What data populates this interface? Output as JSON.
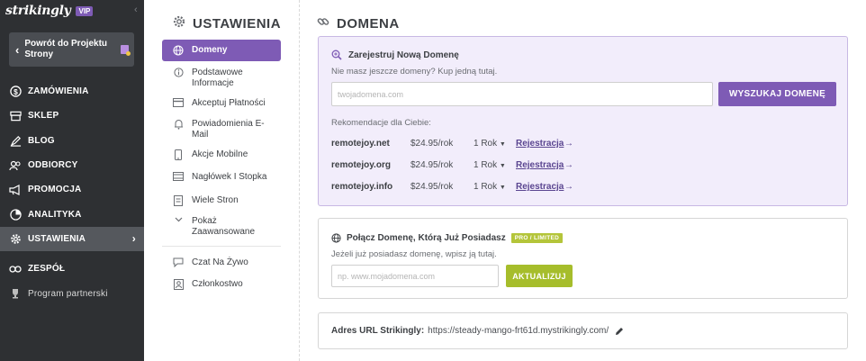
{
  "brand": {
    "logo": "strikingly",
    "vip": "VIP"
  },
  "back_button": {
    "label": "Powrót do Projektu Strony"
  },
  "sidebar": {
    "items": [
      {
        "label": "ZAMÓWIENIA",
        "icon": "dollar-icon"
      },
      {
        "label": "SKLEP",
        "icon": "store-icon"
      },
      {
        "label": "BLOG",
        "icon": "blog-icon"
      },
      {
        "label": "ODBIORCY",
        "icon": "audience-icon"
      },
      {
        "label": "PROMOCJA",
        "icon": "megaphone-icon"
      },
      {
        "label": "ANALITYKA",
        "icon": "analytics-icon"
      },
      {
        "label": "USTAWIENIA",
        "icon": "gear-icon"
      },
      {
        "label": "ZESPÓŁ",
        "icon": "team-icon"
      },
      {
        "label": "Program partnerski",
        "icon": "trophy-icon"
      }
    ]
  },
  "settings": {
    "title": "USTAWIENIA",
    "items": [
      {
        "label": "Domeny",
        "icon": "globe-icon"
      },
      {
        "label": "Podstawowe Informacje",
        "icon": "info-icon"
      },
      {
        "label": "Akceptuj Płatności",
        "icon": "payment-icon"
      },
      {
        "label": "Powiadomienia E-Mail",
        "icon": "bell-icon"
      },
      {
        "label": "Akcje Mobilne",
        "icon": "mobile-icon"
      },
      {
        "label": "Nagłówek I Stopka",
        "icon": "header-icon"
      },
      {
        "label": "Wiele Stron",
        "icon": "pages-icon"
      },
      {
        "label": "Pokaż Zaawansowane",
        "icon": "chevron-down-icon"
      },
      {
        "label": "Czat Na Żywo",
        "icon": "chat-icon"
      },
      {
        "label": "Członkostwo",
        "icon": "membership-icon"
      }
    ]
  },
  "main": {
    "title": "DOMENA",
    "register": {
      "heading": "Zarejestruj Nową Domenę",
      "subtext": "Nie masz jeszcze domeny? Kup jedną tutaj.",
      "input_placeholder": "twojadomena.com",
      "search_button": "WYSZUKAJ DOMENĘ",
      "recommend_label": "Rekomendacje dla Ciebie:",
      "recommendations": [
        {
          "domain": "remotejoy.net",
          "price": "$24.95/rok",
          "term": "1 Rok",
          "action": "Rejestracja"
        },
        {
          "domain": "remotejoy.org",
          "price": "$24.95/rok",
          "term": "1 Rok",
          "action": "Rejestracja"
        },
        {
          "domain": "remotejoy.info",
          "price": "$24.95/rok",
          "term": "1 Rok",
          "action": "Rejestracja"
        }
      ]
    },
    "connect": {
      "heading": "Połącz Domenę, Którą Już Posiadasz",
      "badge": "PRO / LIMITED",
      "subtext": "Jeżeli już posiadasz domenę, wpisz ją tutaj.",
      "input_placeholder": "np. www.mojadomena.com",
      "button": "AKTUALIZUJ"
    },
    "url": {
      "label": "Adres URL Strikingly:",
      "value": "https://steady-mango-frt61d.mystrikingly.com/"
    }
  },
  "colors": {
    "sidebar": "#2e3033",
    "accent_purple": "#7e5bb5",
    "accent_green": "#a6bd2b",
    "card_purple_bg": "#f2edfb"
  }
}
